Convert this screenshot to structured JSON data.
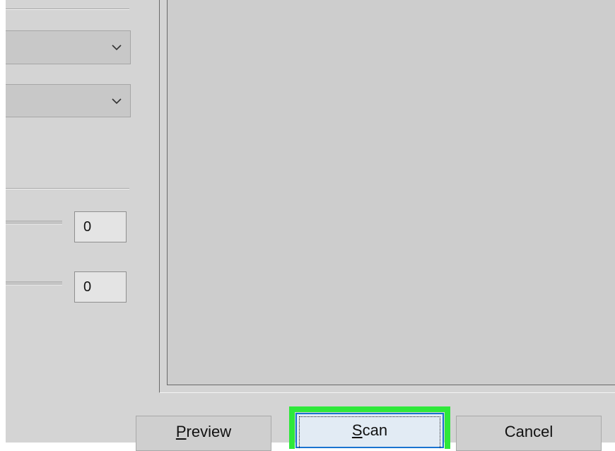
{
  "settings_panel": {
    "combo_1": {
      "value": "",
      "icon": "chevron-down-icon"
    },
    "combo_2": {
      "value": "",
      "icon": "chevron-down-icon"
    },
    "brightness": {
      "value": "0"
    },
    "contrast": {
      "value": "0"
    }
  },
  "buttons": {
    "preview": {
      "prefix": "",
      "accel": "P",
      "rest": "review"
    },
    "scan": {
      "prefix": "",
      "accel": "S",
      "rest": "can"
    },
    "cancel": {
      "label": "Cancel"
    }
  },
  "colors": {
    "dialog_bg": "#d4d4d4",
    "preview_bg": "#cdcdcd",
    "highlight": "#2ee83a",
    "default_button_border": "#1a73d0"
  }
}
